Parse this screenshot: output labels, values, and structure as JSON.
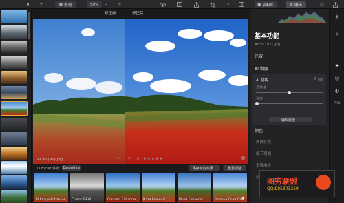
{
  "toolbar": {
    "view_label": "外观",
    "zoom_label": "50%",
    "library_tab": "资料库",
    "edit_tab": "编辑"
  },
  "canvas": {
    "before_label": "修正前",
    "after_label": "修正后",
    "file_info": "Ac30 (92).jpg",
    "stars": "★★★★★"
  },
  "looks_bar": {
    "section_label": "Luminar 外观:",
    "category": "Essentials",
    "save_label": "保存新的效果...",
    "reset_label": "重置调整",
    "items": [
      {
        "label": "AI Image Enhancer"
      },
      {
        "label": "Classic B&W"
      },
      {
        "label": "Contrast Enhancer"
      },
      {
        "label": "Haze Removal"
      },
      {
        "label": "Mood Enhancer"
      },
      {
        "label": "Remove Color Cast"
      }
    ]
  },
  "panel": {
    "title": "基本功能",
    "subtitle": "Ac30 (92).jpg",
    "sections": [
      "光效",
      "AI 增强",
      "颜色"
    ],
    "ai_box": {
      "title": "AI 结构",
      "slider1_label": "调整量",
      "slider1_value": 0.5,
      "slider2_label": "强度",
      "slider2_value": 0.02,
      "mask_button": "编辑蒙版"
    },
    "items": [
      "黑白转换",
      "细节增强",
      "消除噪点",
      "风景增强"
    ]
  },
  "watermark": {
    "main": "图穷联盟",
    "sub": "QQ:985303259"
  },
  "colors": {
    "accent": "#e8b03b",
    "panel_bg": "#232326",
    "toolbar_bg": "#2a2a2d"
  }
}
